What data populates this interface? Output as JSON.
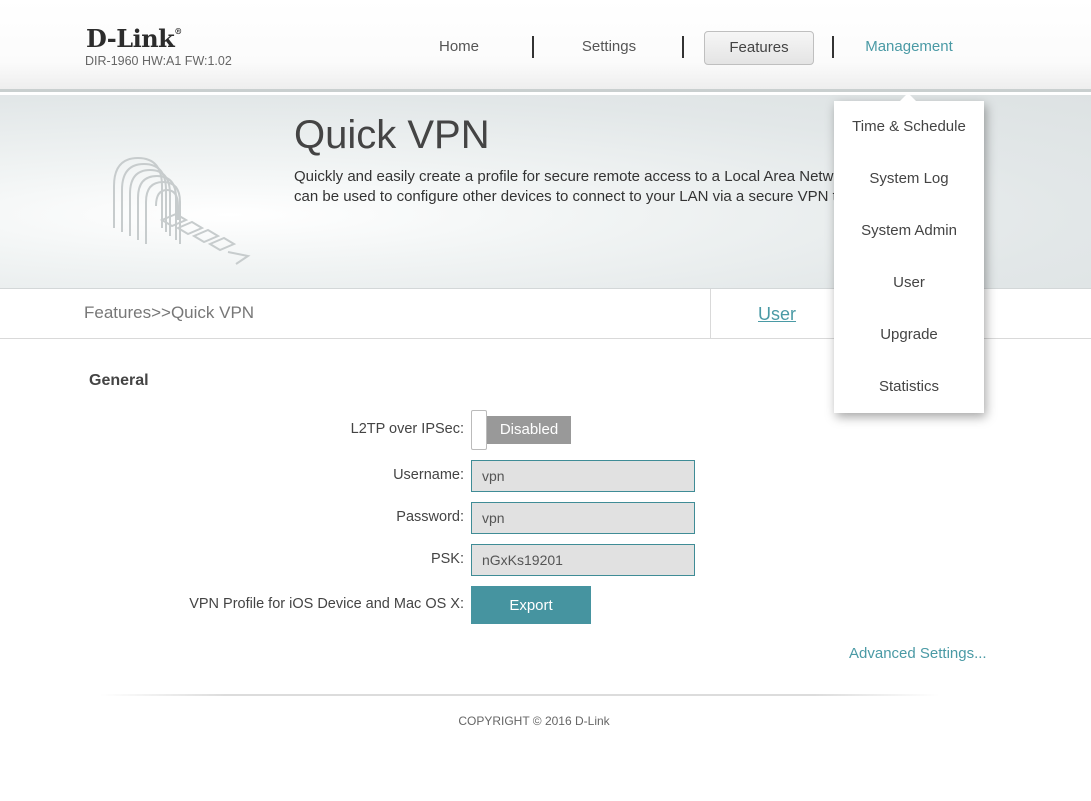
{
  "header": {
    "logo": "D-Link",
    "logo_mark": "®",
    "model_info": "DIR-1960 HW:A1 FW:1.02"
  },
  "nav": {
    "home": "Home",
    "settings": "Settings",
    "features": "Features",
    "management": "Management"
  },
  "banner": {
    "title": "Quick VPN",
    "description_line1": "Quickly and easily create a profile for secure remote access to a Local Area Network",
    "description_line2": "can be used to configure other devices to connect to your LAN via a secure VPN tunnel"
  },
  "breadcrumb": "Features>>Quick VPN",
  "user_tab": "User",
  "general": {
    "title": "General",
    "l2tp_label": "L2TP over IPSec:",
    "l2tp_state": "Disabled",
    "username_label": "Username:",
    "username_value": "vpn",
    "password_label": "Password:",
    "password_value": "vpn",
    "psk_label": "PSK:",
    "psk_value": "nGxKs19201",
    "vpn_profile_label": "VPN Profile for iOS Device and Mac OS X:",
    "export_label": "Export"
  },
  "advanced_settings": "Advanced Settings...",
  "copyright": "COPYRIGHT © 2016 D-Link",
  "management_menu": {
    "items": [
      {
        "label": "Time & Schedule"
      },
      {
        "label": "System Log"
      },
      {
        "label": "System Admin"
      },
      {
        "label": "User"
      },
      {
        "label": "Upgrade"
      },
      {
        "label": "Statistics"
      }
    ]
  },
  "colors": {
    "accent": "#4a9aa5",
    "button": "#4694a0",
    "toggle_off": "#999999"
  }
}
